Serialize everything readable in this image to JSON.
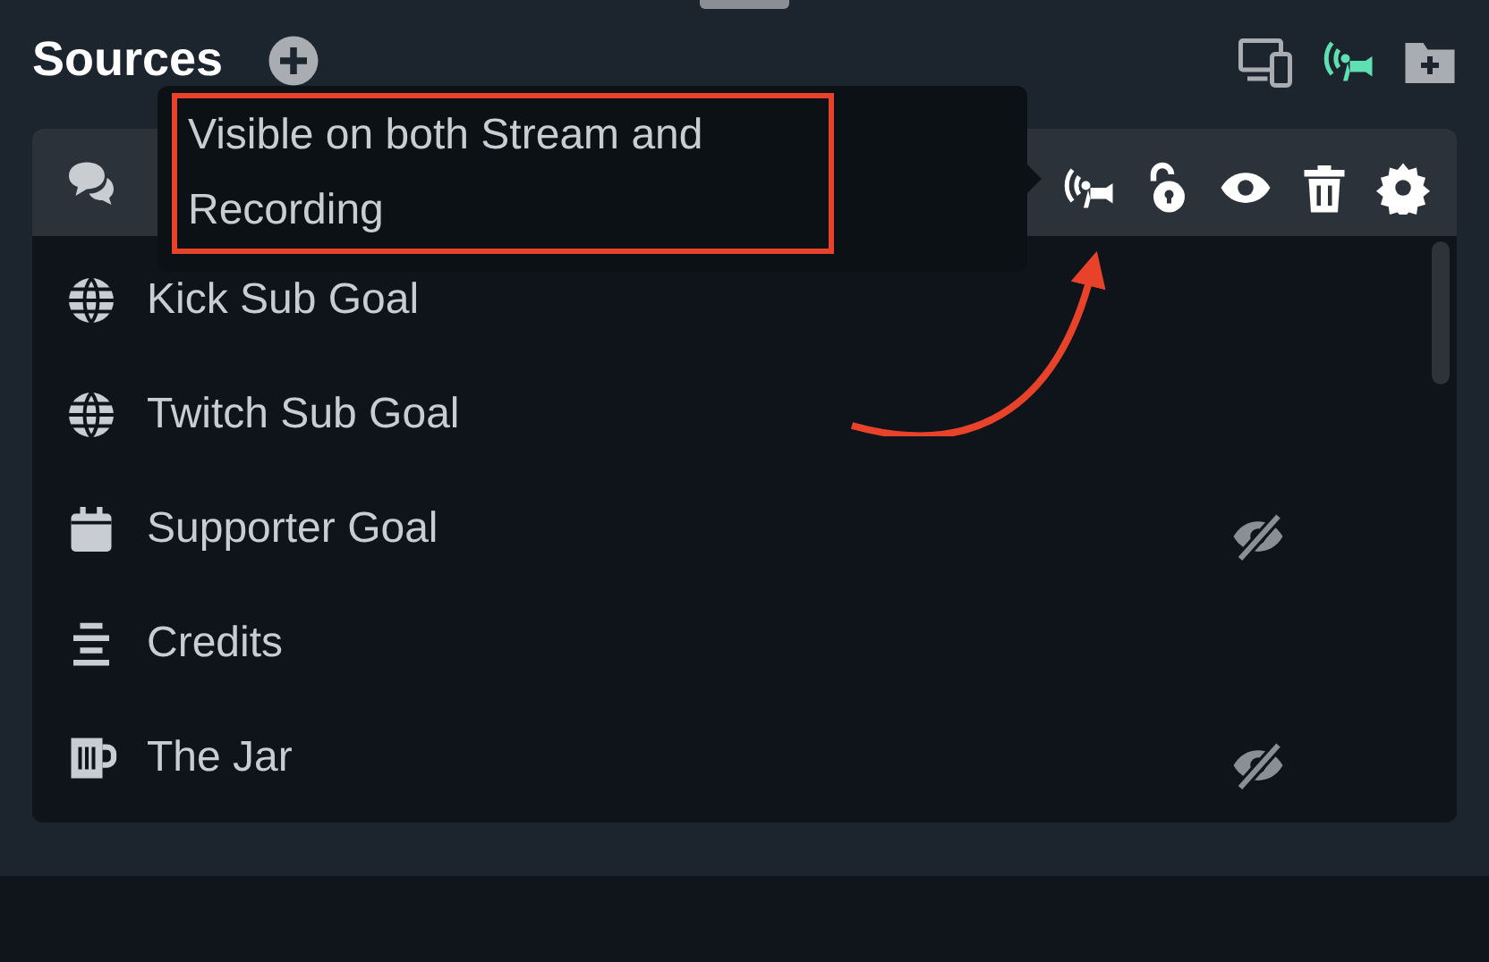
{
  "header": {
    "title": "Sources",
    "toolbar": [
      {
        "kind": "devices",
        "active": false
      },
      {
        "kind": "broadcast",
        "active": true
      },
      {
        "kind": "folder-add",
        "active": false
      }
    ]
  },
  "sources": [
    {
      "kind": "chat",
      "selected": true,
      "hidden": false
    },
    {
      "kind": "web",
      "name": "Kick Sub Goal",
      "selected": false,
      "hidden": false
    },
    {
      "kind": "web",
      "name": "Twitch Sub Goal",
      "selected": false,
      "hidden": false
    },
    {
      "kind": "goal",
      "name": "Supporter Goal",
      "selected": false,
      "hidden": true
    },
    {
      "kind": "credits",
      "name": "Credits",
      "selected": false,
      "hidden": false
    },
    {
      "kind": "jar",
      "name": "The Jar",
      "selected": false,
      "hidden": true
    }
  ],
  "tooltip": {
    "text": "Visible on both Stream and Recording"
  }
}
